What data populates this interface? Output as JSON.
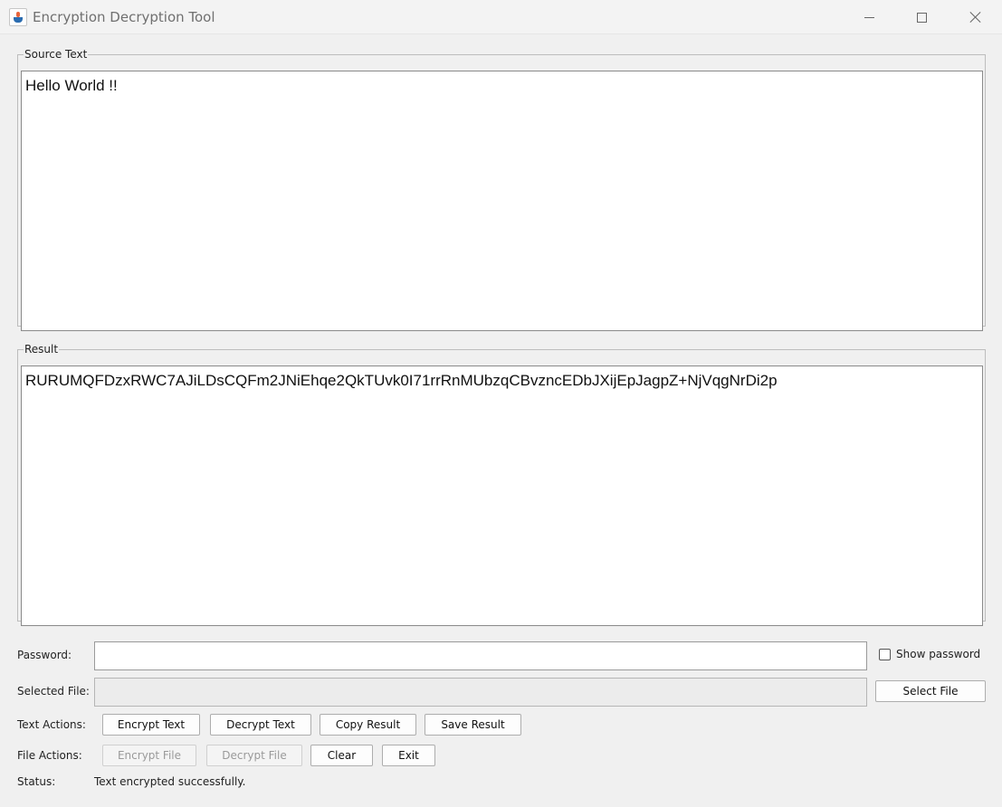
{
  "window": {
    "title": "Encryption Decryption Tool"
  },
  "source": {
    "legend": "Source Text",
    "text": "Hello World !!"
  },
  "result": {
    "legend": "Result",
    "text": "RURUMQFDzxRWC7AJiLDsCQFm2JNiEhqe2QkTUvk0I71rrRnMUbzqCBvzncEDbJXijEpJagpZ+NjVqgNrDi2p"
  },
  "password": {
    "label": "Password:",
    "value": "",
    "show_label": "Show password",
    "show_checked": false
  },
  "file": {
    "label": "Selected File:",
    "value": "",
    "select_label": "Select File"
  },
  "text_actions": {
    "label": "Text Actions:",
    "encrypt": "Encrypt Text",
    "decrypt": "Decrypt Text",
    "copy": "Copy Result",
    "save": "Save Result"
  },
  "file_actions": {
    "label": "File Actions:",
    "encrypt": "Encrypt File",
    "decrypt": "Decrypt File",
    "clear": "Clear",
    "exit": "Exit"
  },
  "status": {
    "label": "Status:",
    "text": "Text encrypted successfully."
  }
}
